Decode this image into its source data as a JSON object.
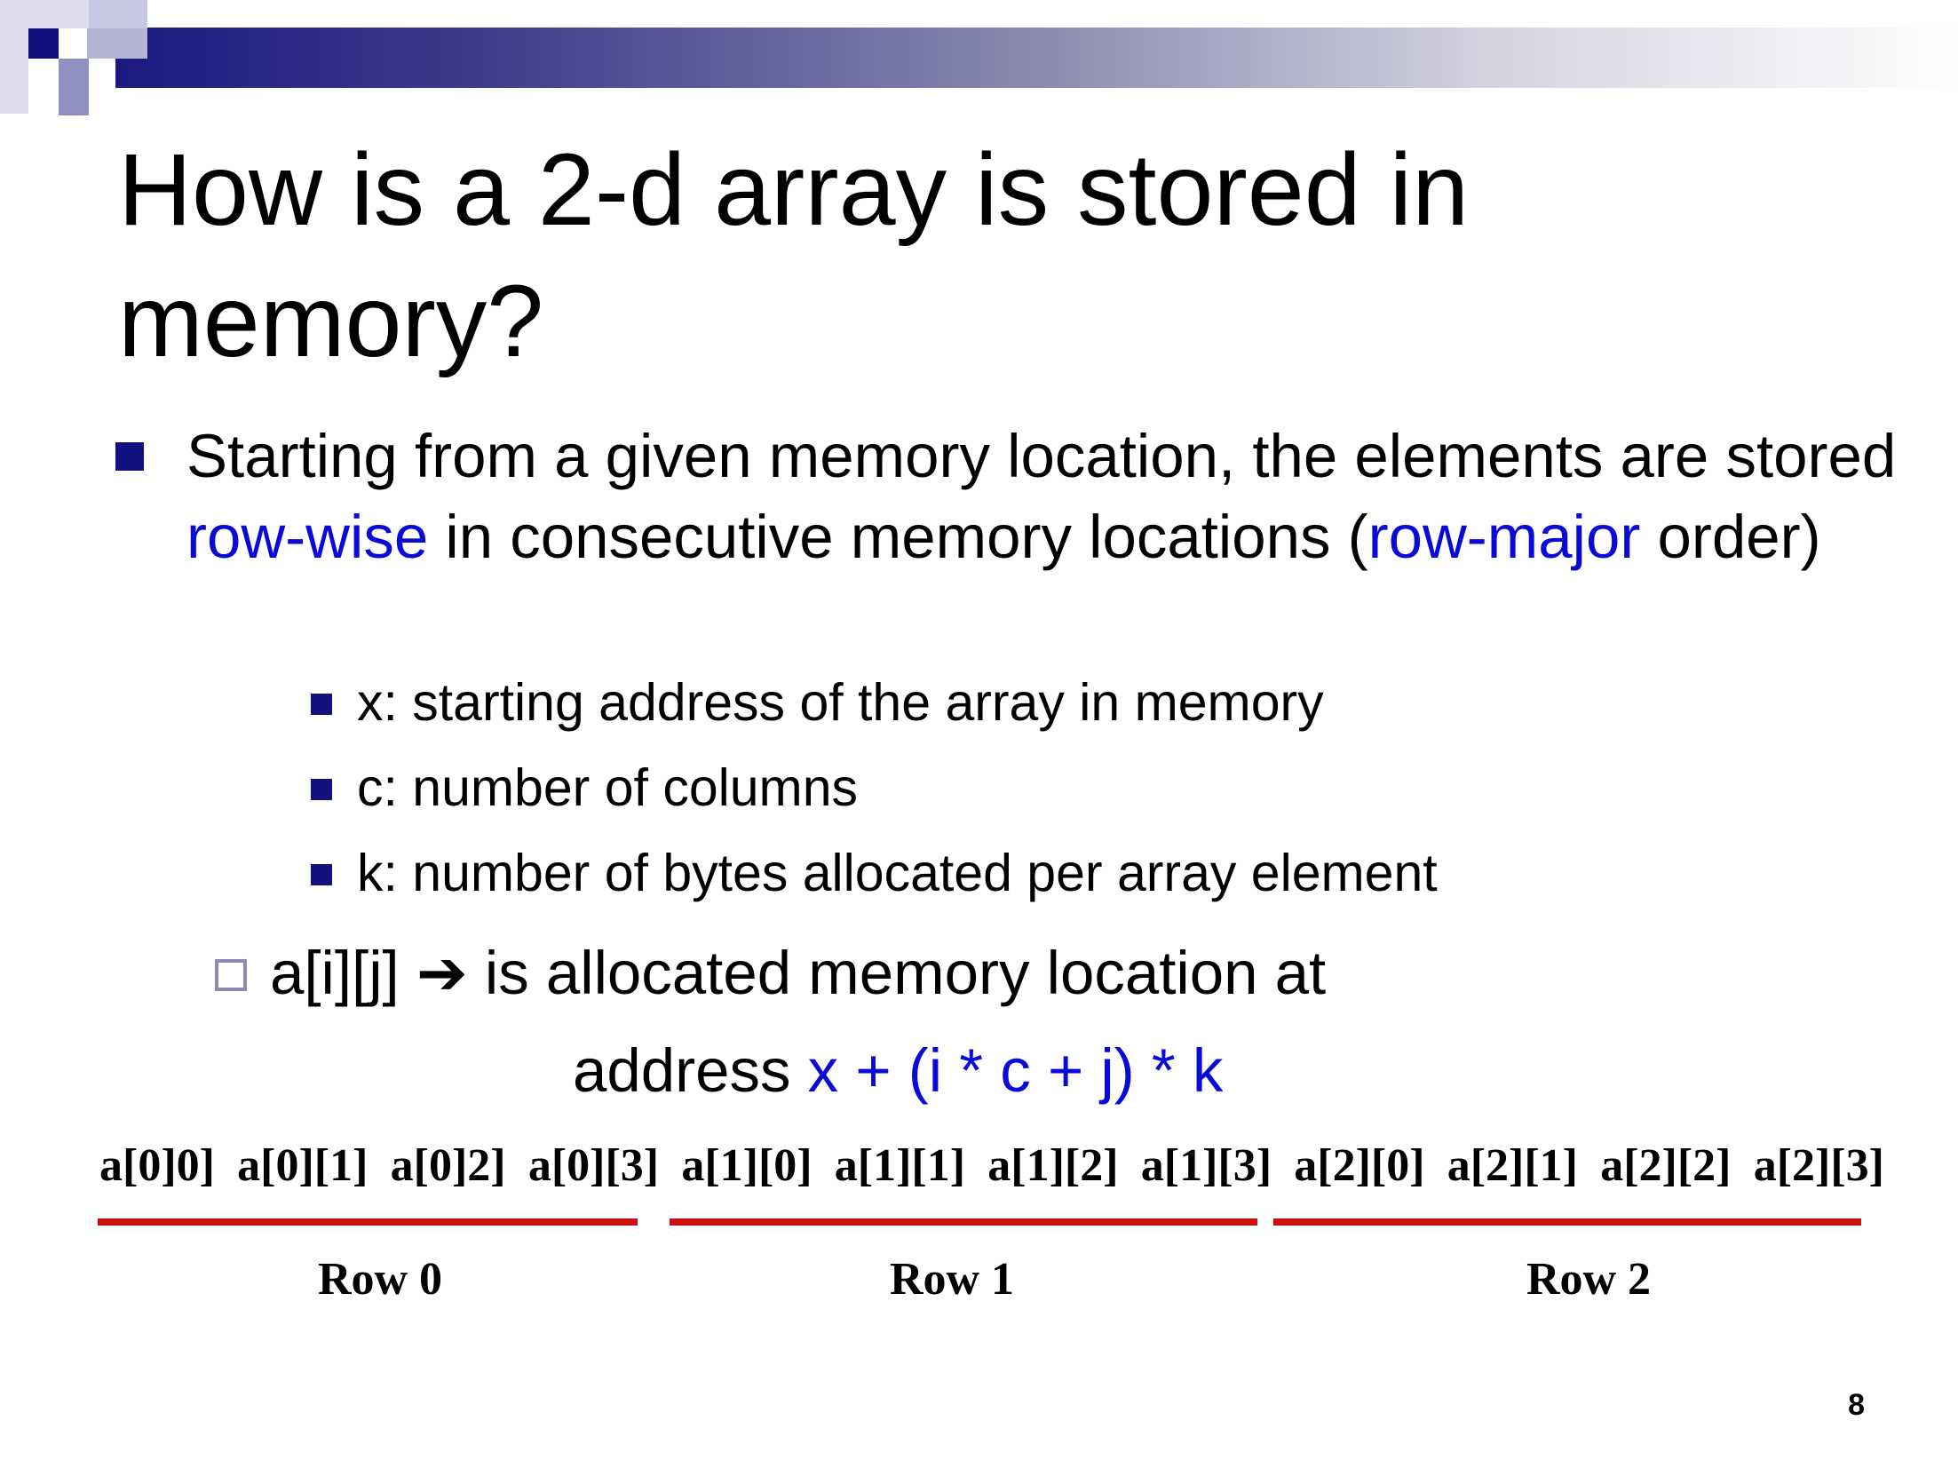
{
  "colors": {
    "title_bar_dark": "#1a1a80",
    "bullet": "#101080",
    "highlight_blue": "#0a0ad8",
    "row_underline": "#cc1111"
  },
  "slide": {
    "title": "How is a 2-d array is stored in memory?",
    "bullet": {
      "part1": "Starting from a given memory location, the elements are stored ",
      "highlight1": "row-wise",
      "part2": " in consecutive memory locations (",
      "highlight2": "row-major",
      "part3": " order)"
    },
    "sub_bullets": [
      "x: starting address of the array in memory",
      "c: number of columns",
      "k: number of bytes allocated per array element"
    ],
    "allocation": {
      "lhs": "a[i][j] ",
      "arrow": "➔",
      "rhs": " is allocated memory location at",
      "address_label": "address  ",
      "formula": "x + (i * c + j) * k"
    },
    "cells": [
      "a[0]0]",
      "a[0][1]",
      "a[0]2]",
      "a[0][3]",
      "a[1][0]",
      "a[1][1]",
      "a[1][2]",
      "a[1][3]",
      "a[2][0]",
      "a[2][1]",
      "a[2][2]",
      "a[2][3]"
    ],
    "rows": [
      "Row 0",
      "Row 1",
      "Row 2"
    ],
    "page_number": "8"
  }
}
